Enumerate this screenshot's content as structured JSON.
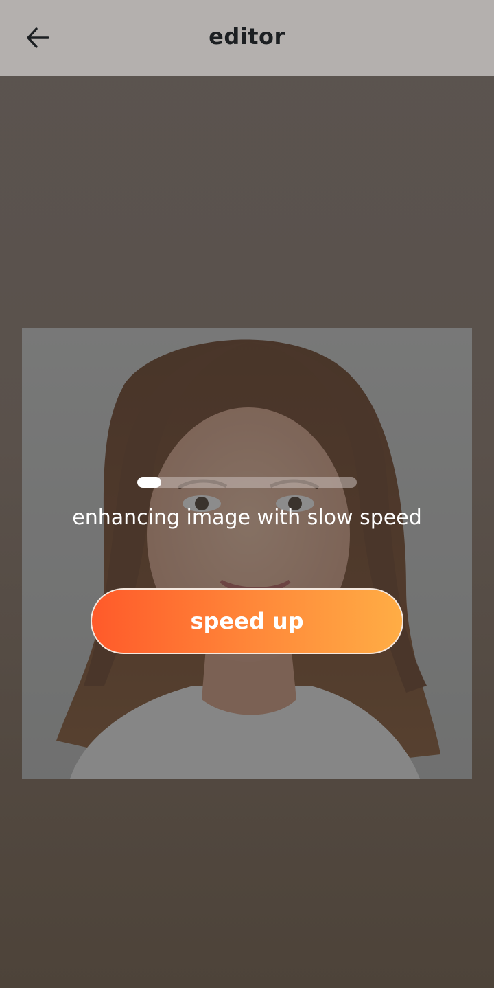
{
  "header": {
    "title": "editor",
    "back_icon": "arrow-left-icon"
  },
  "photo": {
    "subject": "portrait-photo"
  },
  "enhance": {
    "progress_fraction": 0.11,
    "status_text": "enhancing image with slow speed",
    "speed_up_label": "speed up"
  },
  "colors": {
    "app_bar": "#b4b0ae",
    "background": "#57504a",
    "button_start": "#ff5a2a",
    "button_end": "#ffad45"
  }
}
